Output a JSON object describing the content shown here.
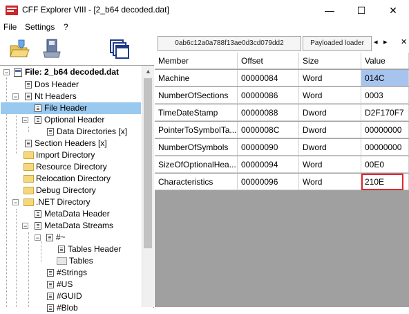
{
  "window": {
    "title": "CFF Explorer VIII - [2_b64 decoded.dat]",
    "minimize": "—",
    "maximize": "☐",
    "close": "✕"
  },
  "menu": {
    "file": "File",
    "settings": "Settings",
    "help": "?"
  },
  "toolbar": {
    "open_icon": "open-folder-icon",
    "save_icon": "save-disk-icon",
    "windows_icon": "windows-icon"
  },
  "tabs": [
    {
      "label": "0ab6c12a0a788f13ae0d3cd079dd2"
    },
    {
      "label": "Payloaded loader"
    }
  ],
  "tab_nav": {
    "prev": "◂",
    "next": "▸",
    "close": "✕"
  },
  "tree": {
    "root": "File: 2_b64 decoded.dat",
    "items": [
      {
        "label": "Dos Header"
      },
      {
        "label": "Nt Headers"
      },
      {
        "label": "File Header"
      },
      {
        "label": "Optional Header"
      },
      {
        "label": "Data Directories [x]"
      },
      {
        "label": "Section Headers [x]"
      },
      {
        "label": "Import Directory"
      },
      {
        "label": "Resource Directory"
      },
      {
        "label": "Relocation Directory"
      },
      {
        "label": "Debug Directory"
      },
      {
        "label": ".NET Directory"
      },
      {
        "label": "MetaData Header"
      },
      {
        "label": "MetaData Streams"
      },
      {
        "label": "#~"
      },
      {
        "label": "Tables Header"
      },
      {
        "label": "Tables"
      },
      {
        "label": "#Strings"
      },
      {
        "label": "#US"
      },
      {
        "label": "#GUID"
      },
      {
        "label": "#Blob"
      }
    ]
  },
  "grid": {
    "columns": [
      "Member",
      "Offset",
      "Size",
      "Value"
    ],
    "rows": [
      [
        "Machine",
        "00000084",
        "Word",
        "014C"
      ],
      [
        "NumberOfSections",
        "00000086",
        "Word",
        "0003"
      ],
      [
        "TimeDateStamp",
        "00000088",
        "Dword",
        "D2F170F7"
      ],
      [
        "PointerToSymbolTa...",
        "0000008C",
        "Dword",
        "00000000"
      ],
      [
        "NumberOfSymbols",
        "00000090",
        "Dword",
        "00000000"
      ],
      [
        "SizeOfOptionalHea...",
        "00000094",
        "Word",
        "00E0"
      ],
      [
        "Characteristics",
        "00000096",
        "Word",
        "210E"
      ]
    ]
  },
  "colors": {
    "selection": "#99c9ef",
    "value_highlight": "#a6c4ee",
    "annotation_box": "#e0262f"
  }
}
